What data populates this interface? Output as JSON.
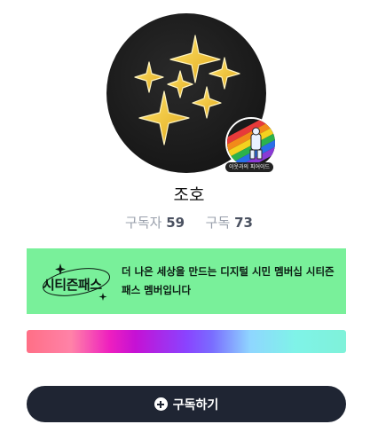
{
  "profile": {
    "name": "조호",
    "badge_label": "이웃과의 피어이드",
    "stats": {
      "subscribers_label": "구독자",
      "subscribers_count": "59",
      "subscriptions_label": "구독",
      "subscriptions_count": "73"
    }
  },
  "banner": {
    "logo_text": "시티즌패스",
    "text": "더 나은 세상을 만드는 디지털 시민 멤버십 시티즌패스 멤버입니다",
    "color": "#79f09a"
  },
  "subscribe_button": {
    "label": "구독하기",
    "icon": "plus-circle-icon",
    "color": "#1f2533"
  }
}
